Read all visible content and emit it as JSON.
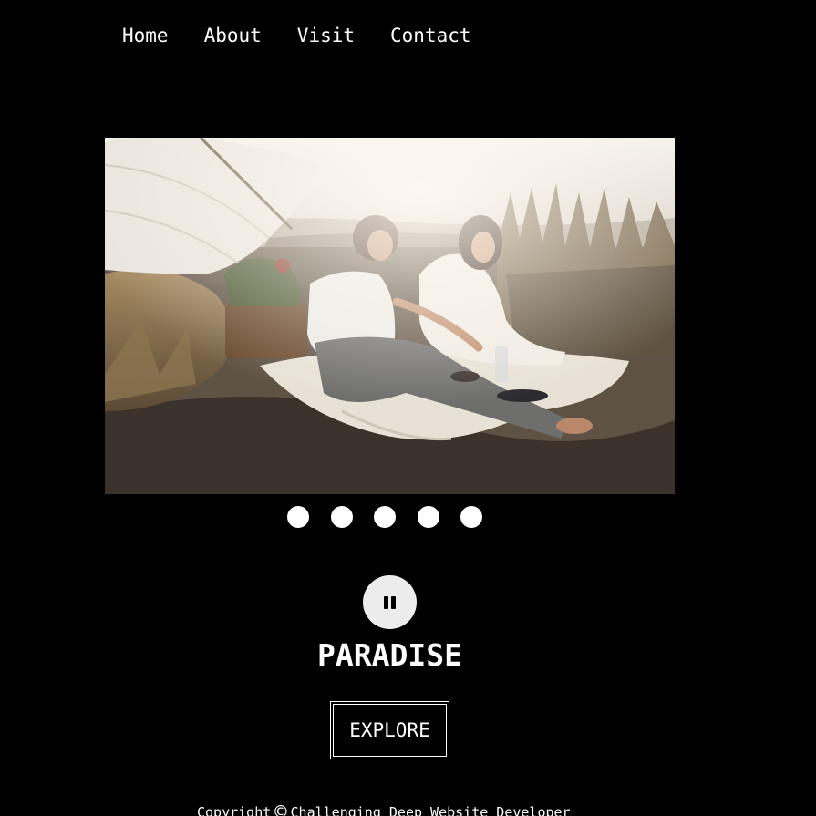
{
  "nav": {
    "items": [
      {
        "label": "Home"
      },
      {
        "label": "About"
      },
      {
        "label": "Visit"
      },
      {
        "label": "Contact"
      }
    ]
  },
  "slider": {
    "image": "photo of a couple having a picnic on a sandy dune under a fringed white umbrella",
    "dot_count": 5,
    "pause_icon": "pause-icon"
  },
  "hero": {
    "title": "PARADISE",
    "cta_label": "EXPLORE"
  },
  "footer": {
    "prefix": "Copyright",
    "symbol": "©",
    "text": "Challenging Deep Website Developer"
  },
  "colors": {
    "background": "#000000",
    "text": "#ffffff",
    "pause_button": "#ececec"
  }
}
